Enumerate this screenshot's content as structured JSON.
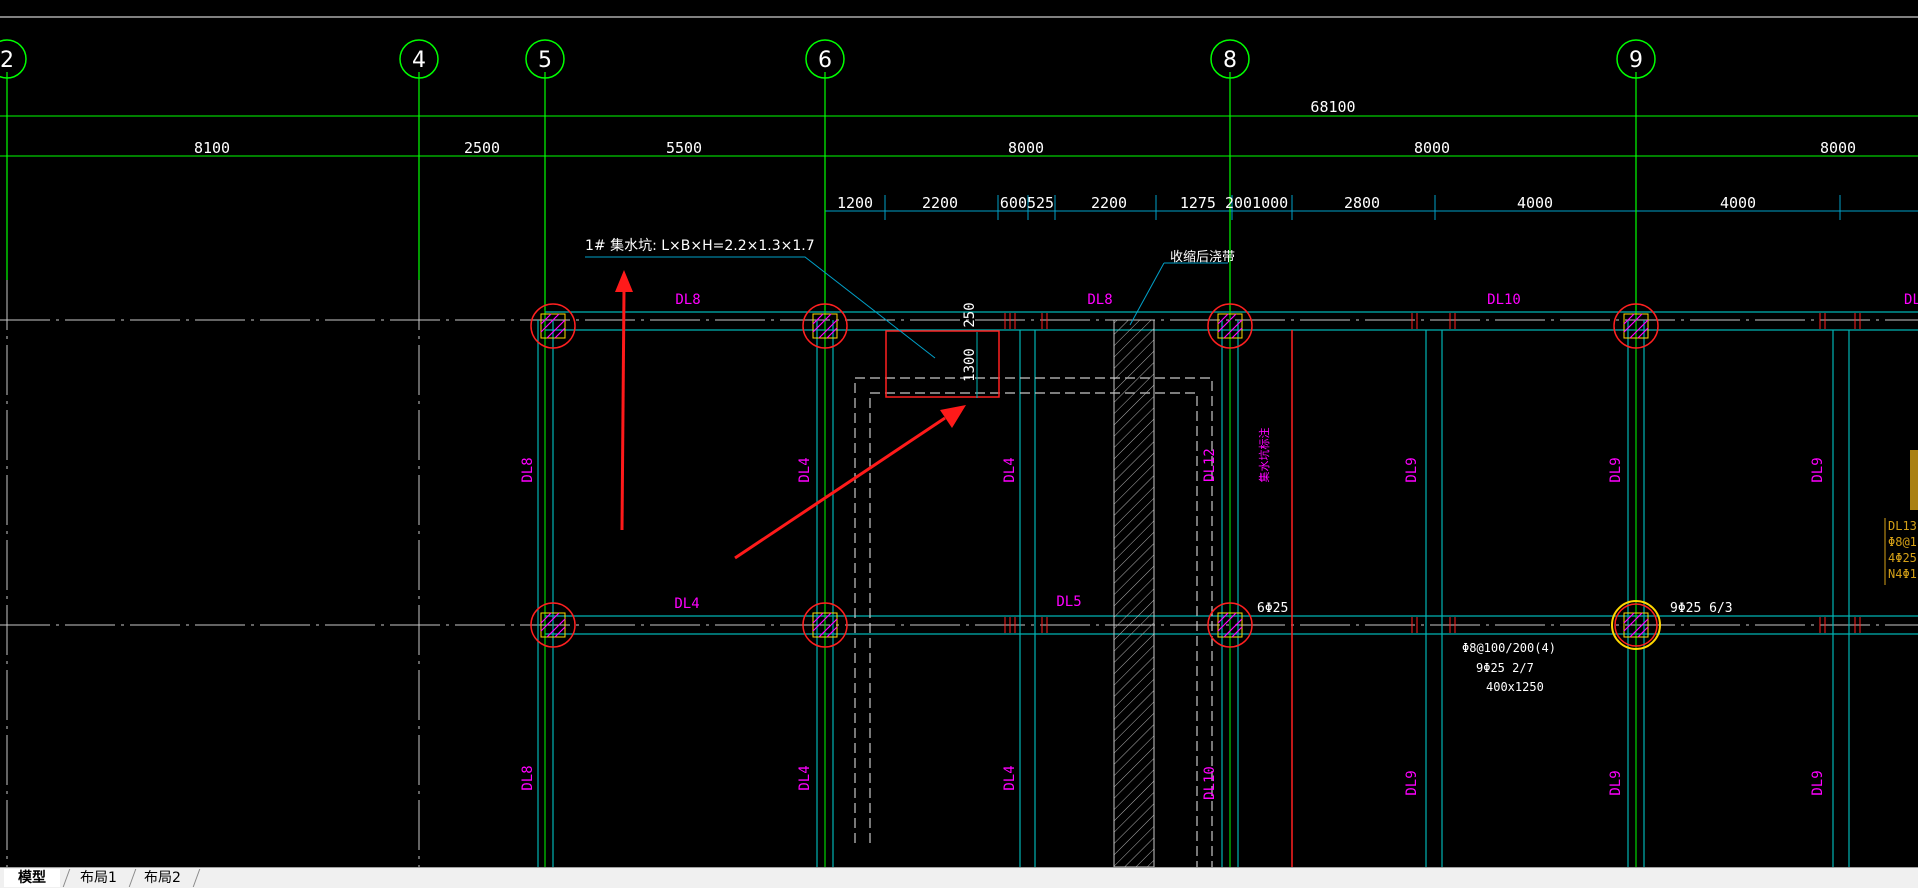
{
  "colors": {
    "background": "#000000",
    "axis": "#00ff00",
    "dim": "#00c8c8",
    "beam": "#00b4b4",
    "beam_label": "#ff00ff",
    "column": "#ff2020",
    "text": "#ffffff",
    "arrow": "#ff1a1a",
    "tag": "#d4a017"
  },
  "grid_axes": [
    "2",
    "4",
    "5",
    "6",
    "8",
    "9"
  ],
  "total_dimension": "68100",
  "bay_dimensions": [
    "8100",
    "2500",
    "5500",
    "8000",
    "8000",
    "8000"
  ],
  "sub_dimensions": [
    "1200",
    "2200",
    "600525",
    "2200",
    "1275 2001000",
    "2800",
    "4000",
    "4000"
  ],
  "annotations": {
    "sump": "1# 集水坑: L×B×H=2.2×1.3×1.7",
    "post_pour": "收缩后浇带",
    "dim_250": "250",
    "dim_1300": "1300",
    "rebar_6": "6Φ25",
    "rebar_9": "9Φ25 6/3",
    "beam_note": [
      "Φ8@100/200(4)",
      "9Φ25 2/7",
      "400x1250"
    ],
    "vertical_note": "集水坑标注",
    "right_tag": [
      "DL13(",
      "Φ8@1",
      "4Φ25",
      "N4Φ1"
    ]
  },
  "beam_labels": {
    "top": [
      "DL8",
      "DL8",
      "DL10",
      "DL"
    ],
    "middle": [
      "DL4",
      "DL5"
    ],
    "col_upper": [
      "DL8",
      "DL4",
      "DL4",
      "DL12",
      "DL9",
      "DL9",
      "DL9"
    ],
    "col_lower": [
      "DL8",
      "DL4",
      "DL4",
      "DL10",
      "DL9",
      "DL9",
      "DL9"
    ]
  },
  "tabs": {
    "model": "模型",
    "layout1": "布局1",
    "layout2": "布局2"
  }
}
